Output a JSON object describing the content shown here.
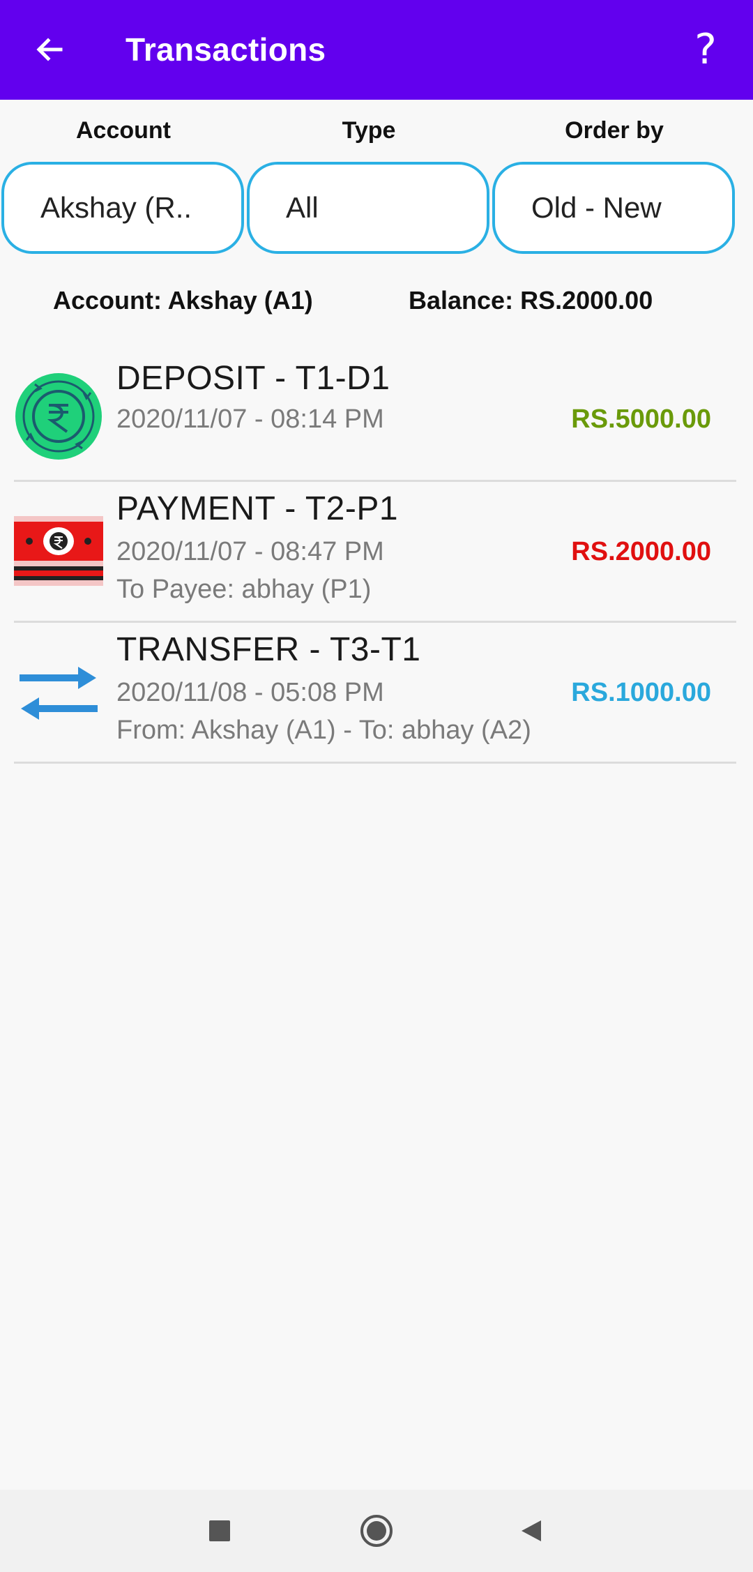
{
  "appbar": {
    "title": "Transactions",
    "back_icon": "arrow-back-icon",
    "help_label": "?"
  },
  "filters": {
    "account": {
      "label": "Account",
      "value": "Akshay (R.."
    },
    "type": {
      "label": "Type",
      "value": "All"
    },
    "order": {
      "label": "Order by",
      "value": "Old - New"
    },
    "border_color": "#2ab0e4"
  },
  "summary": {
    "account": "Account: Akshay (A1)",
    "balance": "Balance: RS.2000.00"
  },
  "transactions": [
    {
      "name": "DEPOSIT - T1-D1",
      "date": "2020/11/07 - 08:14 PM",
      "description": "",
      "amount": "RS.5000.00",
      "amount_color": "#6a9a0a",
      "icon": "deposit-rupee-icon"
    },
    {
      "name": "PAYMENT - T2-P1",
      "date": "2020/11/07 - 08:47 PM",
      "description": "To Payee: abhay (P1)",
      "amount": "RS.2000.00",
      "amount_color": "#e01010",
      "icon": "payment-banknote-icon"
    },
    {
      "name": "TRANSFER - T3-T1",
      "date": "2020/11/08 - 05:08 PM",
      "description": "From: Akshay (A1) - To: abhay (A2)",
      "amount": "RS.1000.00",
      "amount_color": "#2aa8dc",
      "icon": "transfer-arrows-icon"
    }
  ],
  "colors": {
    "appbar": "#6200ee",
    "background": "#f8f8f8"
  },
  "navbar": {
    "icons": [
      "recents-square-icon",
      "home-circle-icon",
      "back-triangle-icon"
    ]
  }
}
